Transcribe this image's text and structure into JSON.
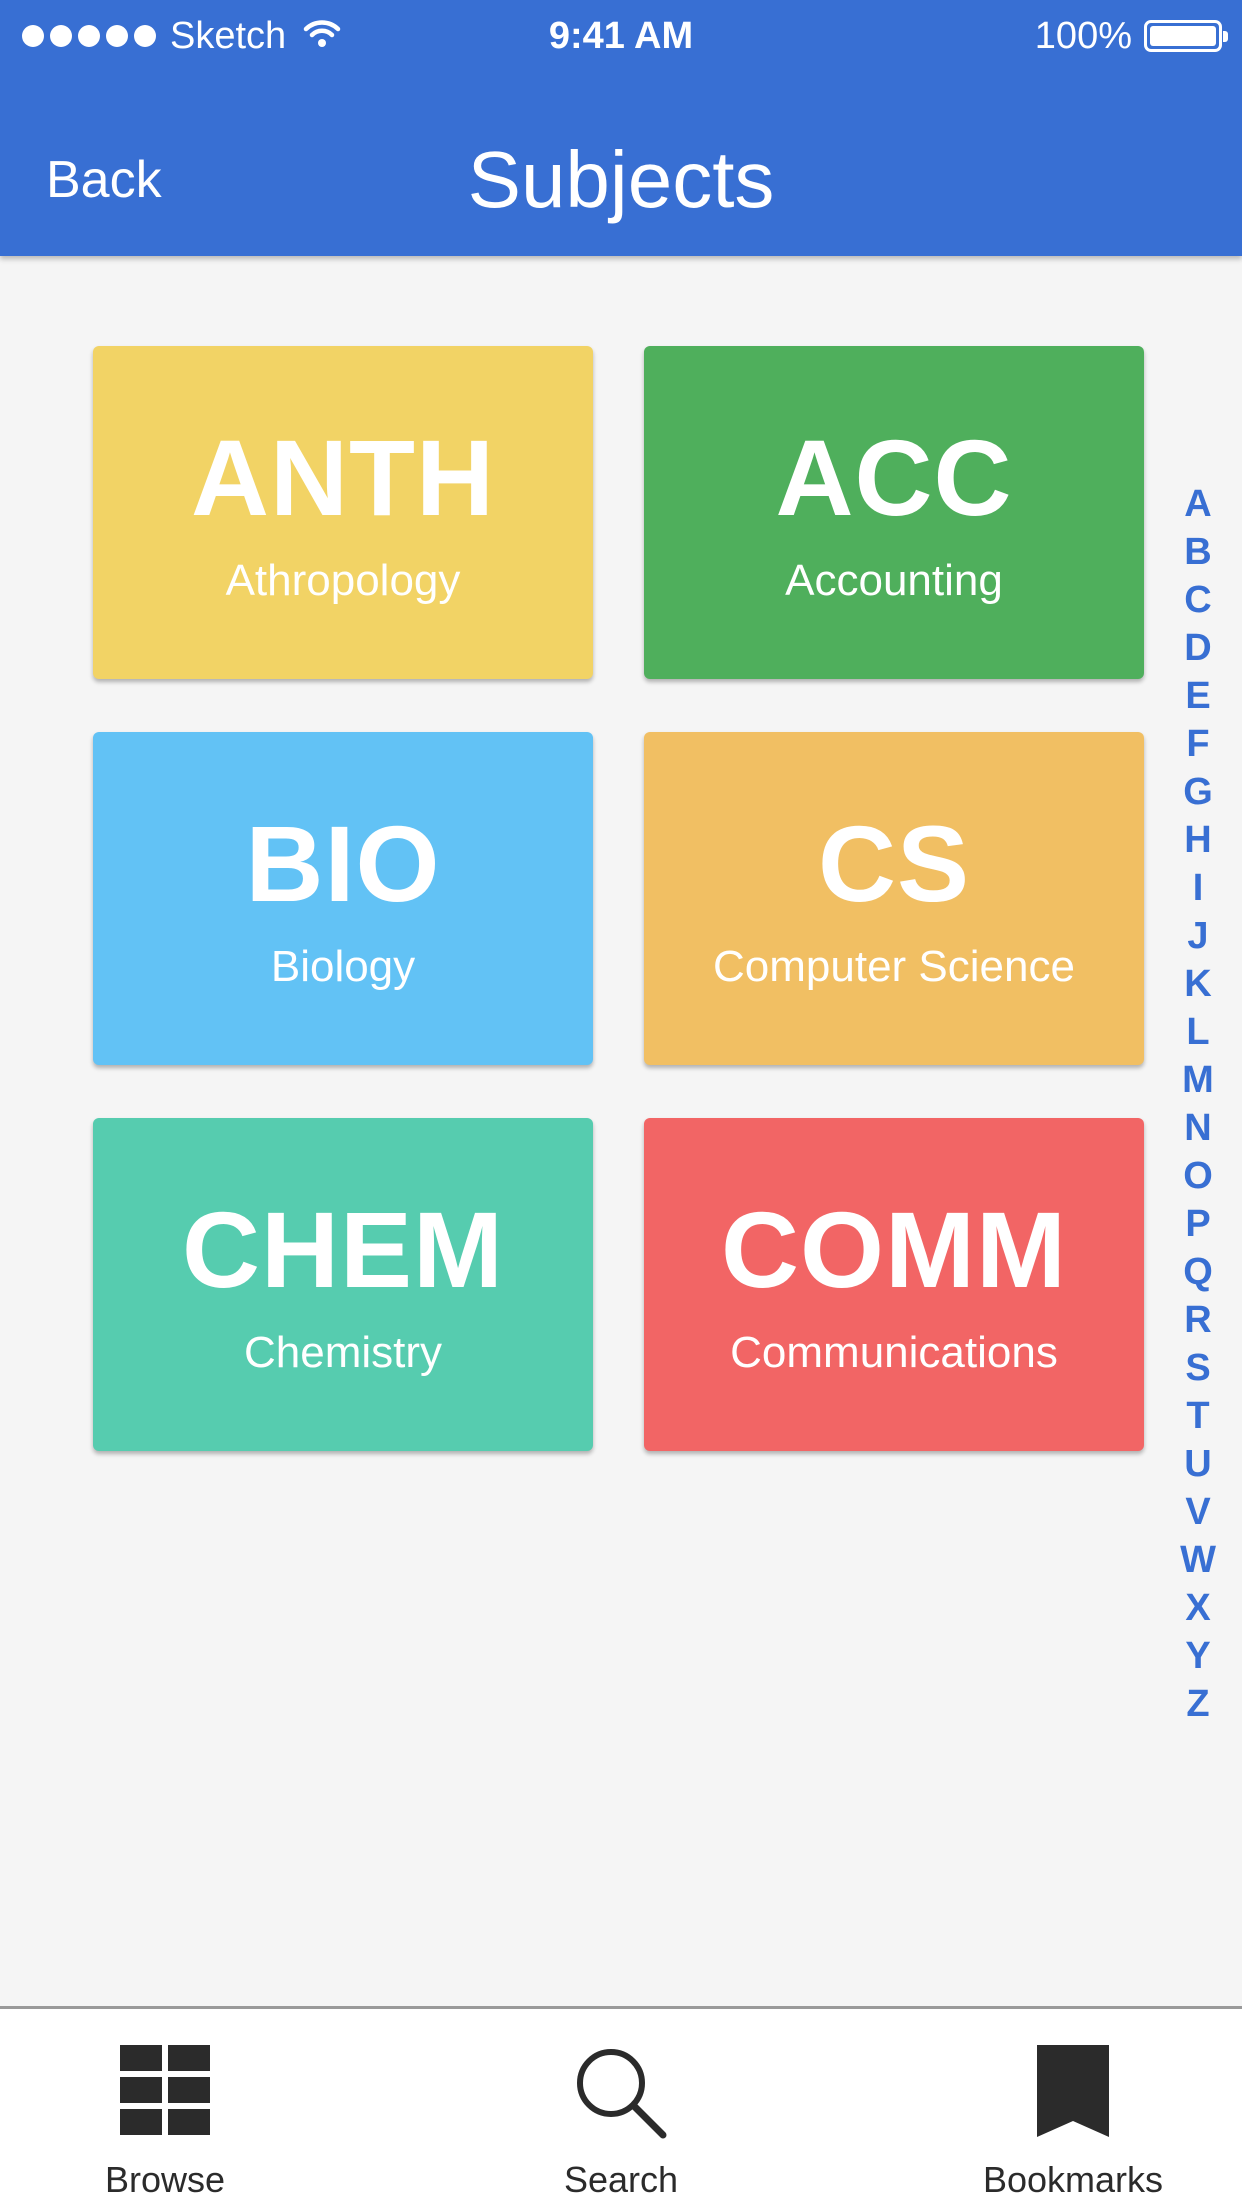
{
  "status_bar": {
    "carrier": "Sketch",
    "time": "9:41 AM",
    "battery": "100%"
  },
  "header": {
    "back_label": "Back",
    "title": "Subjects"
  },
  "subjects": [
    {
      "code": "ANTH",
      "name": "Athropology",
      "color": "#f2d365"
    },
    {
      "code": "ACC",
      "name": "Accounting",
      "color": "#4faf5c"
    },
    {
      "code": "BIO",
      "name": "Biology",
      "color": "#62c2f5"
    },
    {
      "code": "CS",
      "name": "Computer Science",
      "color": "#f1bf63"
    },
    {
      "code": "CHEM",
      "name": "Chemistry",
      "color": "#56ccaf"
    },
    {
      "code": "COMM",
      "name": "Communications",
      "color": "#f26565"
    }
  ],
  "index_letters": [
    "A",
    "B",
    "C",
    "D",
    "E",
    "F",
    "G",
    "H",
    "I",
    "J",
    "K",
    "L",
    "M",
    "N",
    "O",
    "P",
    "Q",
    "R",
    "S",
    "T",
    "U",
    "V",
    "W",
    "X",
    "Y",
    "Z"
  ],
  "tab_bar": {
    "tabs": [
      {
        "label": "Browse",
        "icon": "grid-icon"
      },
      {
        "label": "Search",
        "icon": "magnifier-icon"
      },
      {
        "label": "Bookmarks",
        "icon": "bookmark-icon"
      }
    ]
  },
  "colors": {
    "accent": "#386fd3",
    "background": "#f5f5f5"
  }
}
